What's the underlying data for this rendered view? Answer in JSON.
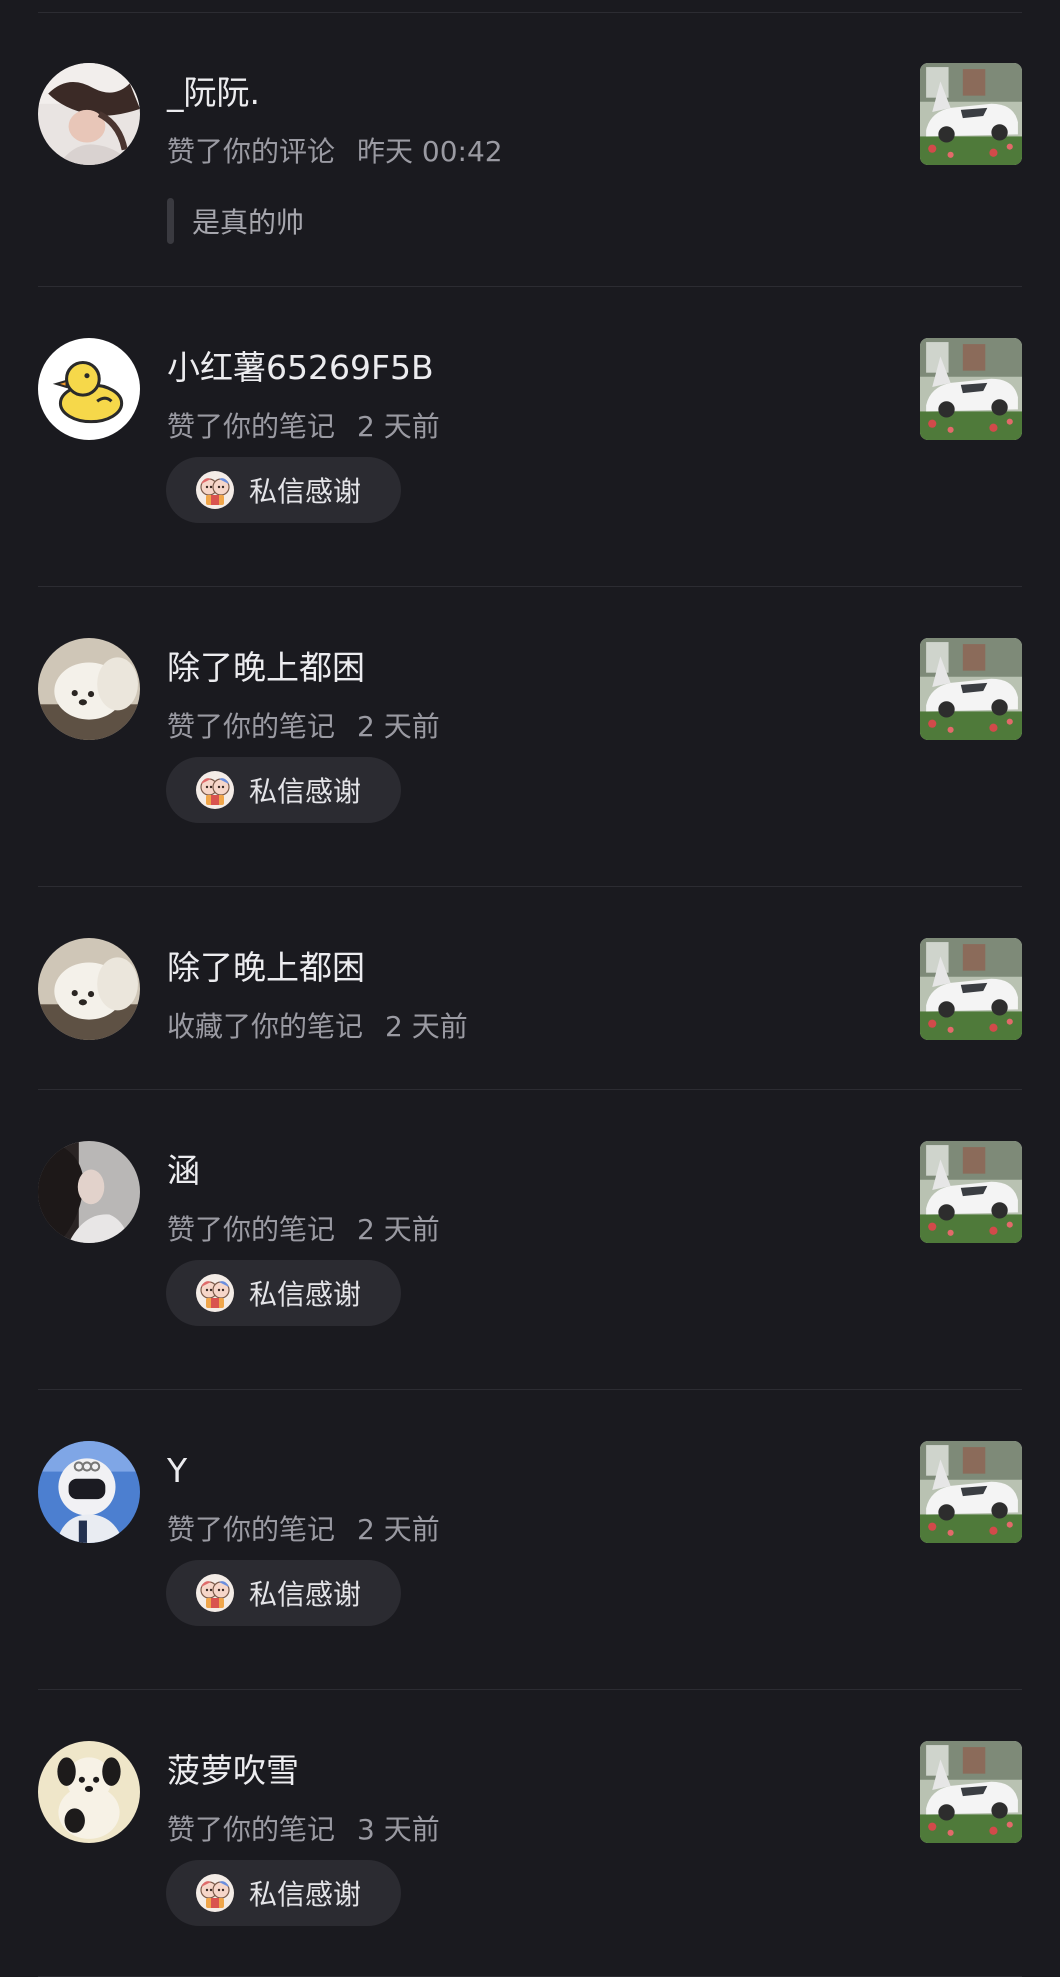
{
  "notifications": [
    {
      "name": "_阮阮.",
      "action": "赞了你的评论",
      "time": "昨天 00:42",
      "quote": "是真的帅",
      "avatar": "woman-photo"
    },
    {
      "name": "小红薯65269F5B",
      "action": "赞了你的笔记",
      "time": "2 天前",
      "thanks_label": "私信感谢",
      "avatar": "yellow-duck"
    },
    {
      "name": "除了晚上都困",
      "action": "赞了你的笔记",
      "time": "2 天前",
      "thanks_label": "私信感谢",
      "avatar": "white-dog"
    },
    {
      "name": "除了晚上都困",
      "action": "收藏了你的笔记",
      "time": "2 天前",
      "avatar": "white-dog"
    },
    {
      "name": "涵",
      "action": "赞了你的笔记",
      "time": "2 天前",
      "thanks_label": "私信感谢",
      "avatar": "girl-portrait"
    },
    {
      "name": "Y",
      "action": "赞了你的笔记",
      "time": "2 天前",
      "thanks_label": "私信感谢",
      "avatar": "helmet-rider"
    },
    {
      "name": "菠萝吹雪",
      "action": "赞了你的笔记",
      "time": "3 天前",
      "thanks_label": "私信感谢",
      "avatar": "plush-dog"
    }
  ],
  "icons": {
    "thanks": "cartoon-thanks-icon",
    "thumbnail": "white-sports-car-photo"
  },
  "colors": {
    "background": "#1a1a1f",
    "name_text": "#ececef",
    "meta_text": "#9a9aa2",
    "chip_background": "#2b2b31"
  }
}
